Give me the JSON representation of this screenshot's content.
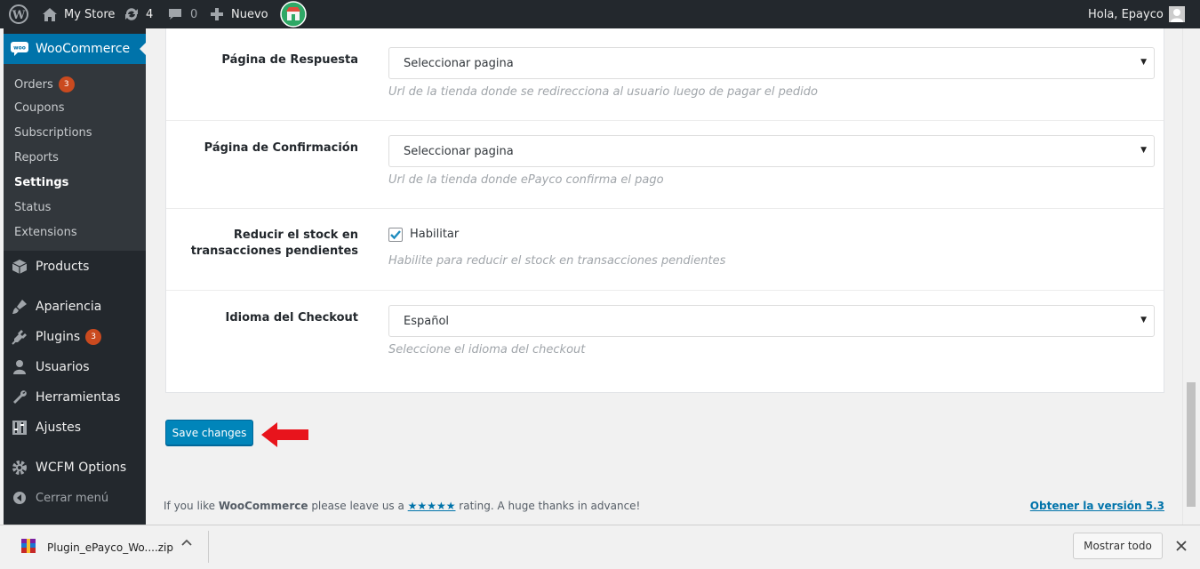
{
  "adminbar": {
    "site_name": "My Store",
    "updates_count": "4",
    "comments_count": "0",
    "new_label": "Nuevo",
    "greeting": "Hola, Epayco"
  },
  "sidebar": {
    "woocommerce_label": "WooCommerce",
    "woo_submenu": [
      {
        "label": "Orders",
        "badge": "3"
      },
      {
        "label": "Coupons"
      },
      {
        "label": "Subscriptions"
      },
      {
        "label": "Reports"
      },
      {
        "label": "Settings"
      },
      {
        "label": "Status"
      },
      {
        "label": "Extensions"
      }
    ],
    "menu": [
      {
        "label": "Products",
        "icon": "box-icon"
      },
      {
        "label": "Apariencia",
        "icon": "brush-icon"
      },
      {
        "label": "Plugins",
        "icon": "plugin-icon",
        "badge": "3"
      },
      {
        "label": "Usuarios",
        "icon": "user-icon"
      },
      {
        "label": "Herramientas",
        "icon": "wrench-icon"
      },
      {
        "label": "Ajustes",
        "icon": "sliders-icon"
      },
      {
        "label": "WCFM Options",
        "icon": "gear-icon"
      },
      {
        "label": "Cerrar menú",
        "icon": "collapse-icon"
      }
    ]
  },
  "settings": {
    "response_page": {
      "label": "Página de Respuesta",
      "value": "Seleccionar pagina",
      "description": "Url de la tienda donde se redirecciona al usuario luego de pagar el pedido"
    },
    "confirmation_page": {
      "label": "Página de Confirmación",
      "value": "Seleccionar pagina",
      "description": "Url de la tienda donde ePayco confirma el pago"
    },
    "reduce_stock": {
      "label_line1": "Reducir el stock en",
      "label_line2": "transacciones pendientes",
      "checkbox_label": "Habilitar",
      "checked": true,
      "description": "Habilite para reducir el stock en transacciones pendientes"
    },
    "checkout_language": {
      "label": "Idioma del Checkout",
      "value": "Español",
      "description": "Seleccione el idioma del checkout"
    }
  },
  "save_button": "Save changes",
  "footer": {
    "prefix": "If you like ",
    "brand": "WooCommerce",
    "middle": " please leave us a ",
    "stars": "★★★★★",
    "suffix": " rating. A huge thanks in advance!",
    "version_link": "Obtener la versión 5.3"
  },
  "downloads": {
    "file_name": "Plugin_ePayco_Wo....zip",
    "show_all": "Mostrar todo"
  },
  "colors": {
    "admin_bg": "#23282d",
    "accent_blue": "#0073aa",
    "button_blue": "#0085ba",
    "badge_orange": "#ca4a1f",
    "annotation_red": "#e8141c"
  }
}
